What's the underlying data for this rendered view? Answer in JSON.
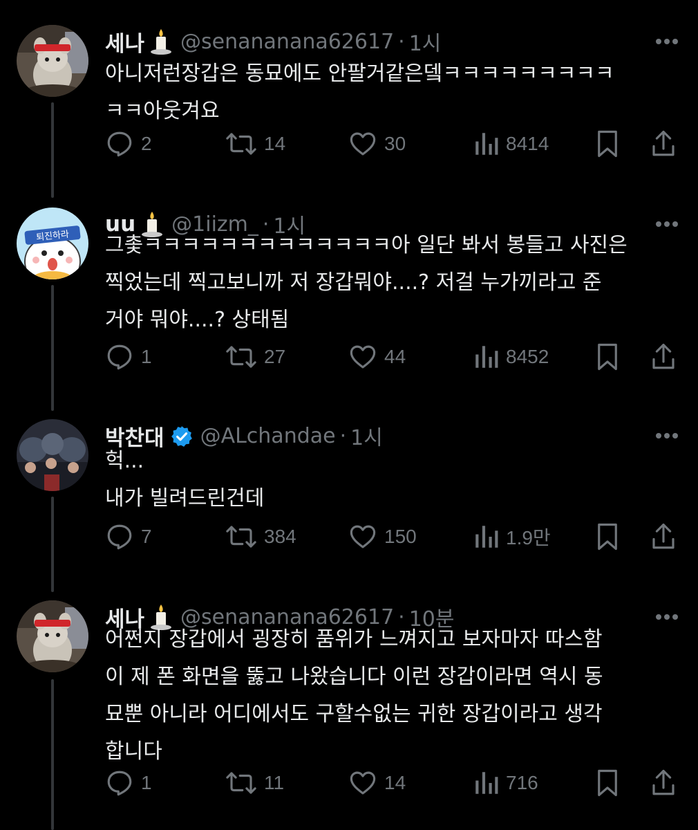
{
  "colors": {
    "background": "#000000",
    "text_primary": "#e7e9ea",
    "text_secondary": "#71767b",
    "thread_line": "#333639",
    "verified_blue": "#1d9bf0"
  },
  "icons": {
    "reply": "speech-bubble-icon",
    "retweet": "retweet-arrows-icon",
    "like": "heart-icon",
    "views": "bar-chart-icon",
    "bookmark": "bookmark-icon",
    "share": "share-upload-icon",
    "more": "three-dots-icon",
    "candle": "candle-emoji-icon",
    "verified": "verified-badge-icon"
  },
  "tweets": [
    {
      "display_name": "세나",
      "handle": "@senananana62617",
      "separator": "·",
      "time": "1시",
      "text": "아니저런장갑은 동묘에도 안팔거같은뎈ㅋㅋㅋㅋㅋㅋㅋㅋㅋ\nㅋㅋ아웃겨요",
      "replies": "2",
      "retweets": "14",
      "likes": "30",
      "views": "8414"
    },
    {
      "display_name": "uu",
      "handle": "@1iizm_",
      "separator": "·",
      "time": "1시",
      "avatar_banner_text": "퇴진하라",
      "text": "그촟ㅋㅋㅋㅋㅋㅋㅋㅋㅋㅋㅋㅋㅋ아 일단 봐서 봉들고 사진은\n찍었는데 찍고보니까 저 장갑뭐야....? 저걸 누가끼라고 준\n거야 뭐야....? 상태됨",
      "replies": "1",
      "retweets": "27",
      "likes": "44",
      "views": "8452"
    },
    {
      "display_name": "박찬대",
      "handle": "@ALchandae",
      "separator": "·",
      "time": "1시",
      "text": "헉...\n내가 빌려드린건데",
      "replies": "7",
      "retweets": "384",
      "likes": "150",
      "views": "1.9만"
    },
    {
      "display_name": "세나",
      "handle": "@senananana62617",
      "separator": "·",
      "time": "10분",
      "text": "어쩐지 장갑에서 굉장히 품위가 느껴지고 보자마자 따스함\n이 제 폰 화면을 뚫고 나왔습니다 이런 장갑이라면 역시 동\n묘뿐 아니라 어디에서도 구할수없는 귀한 장갑이라고 생각\n합니다",
      "replies": "1",
      "retweets": "11",
      "likes": "14",
      "views": "716"
    }
  ]
}
